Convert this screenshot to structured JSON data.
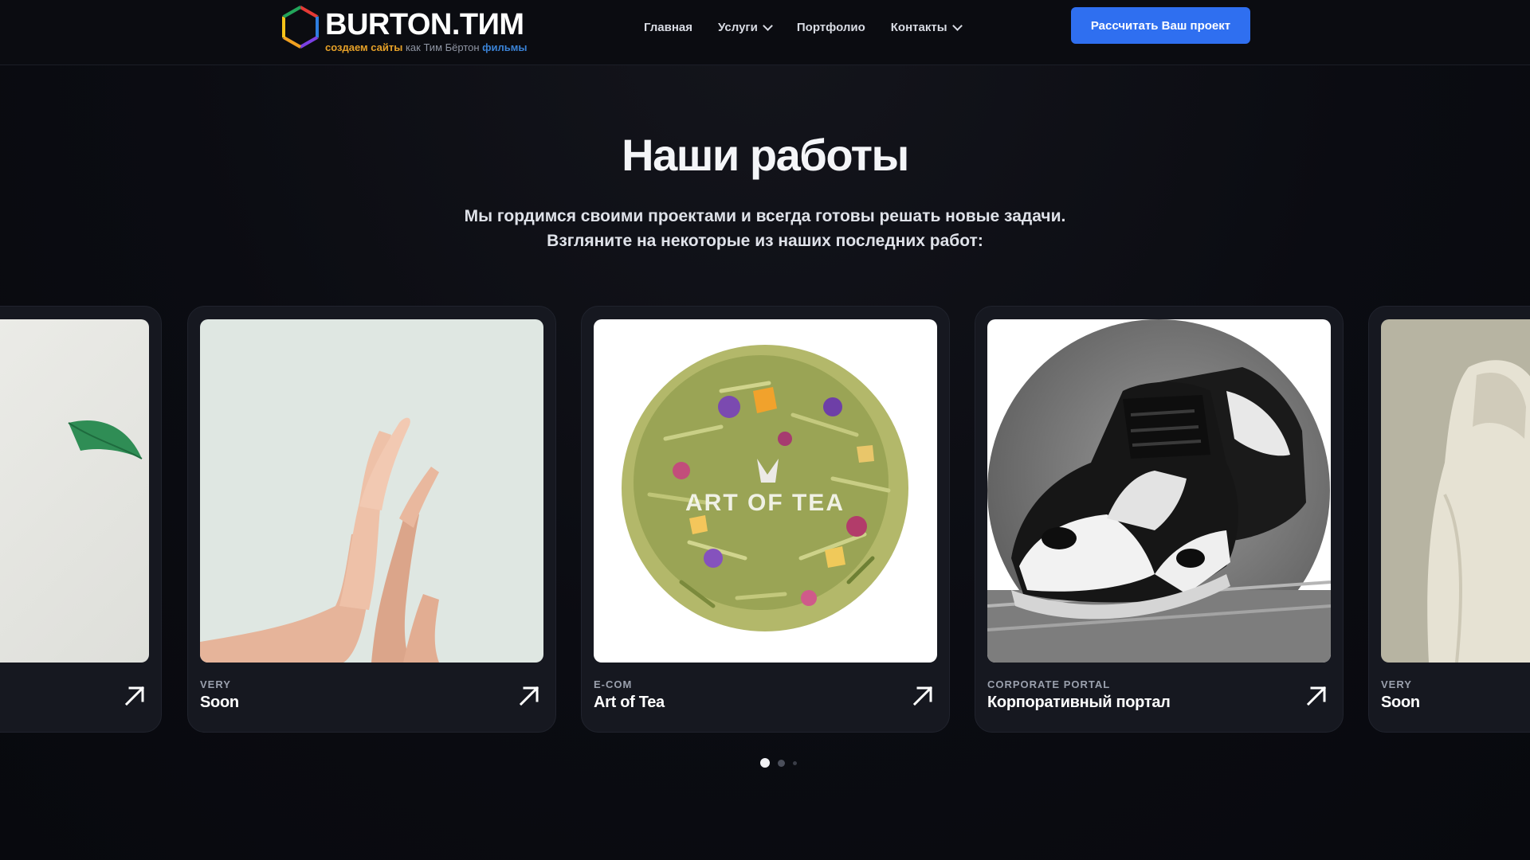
{
  "header": {
    "logo_title": "BURTON.ТИМ",
    "logo_tag_part1": "создаем сайты",
    "logo_tag_part2": "как Тим Бёртон",
    "logo_tag_part3": "фильмы",
    "nav": [
      {
        "label": "Главная",
        "has_dropdown": false
      },
      {
        "label": "Услуги",
        "has_dropdown": true
      },
      {
        "label": "Портфолио",
        "has_dropdown": false
      },
      {
        "label": "Контакты",
        "has_dropdown": true
      }
    ],
    "cta_label": "Рассчитать Ваш проект"
  },
  "section": {
    "title": "Наши работы",
    "subtitle_line1": "Мы гордимся своими проектами и всегда готовы решать новые задачи.",
    "subtitle_line2": "Взгляните на некоторые из наших последних работ:"
  },
  "cards": [
    {
      "category": "",
      "name": "",
      "image": "leaf-on-light-background"
    },
    {
      "category": "VERY",
      "name": "Soon",
      "image": "hands-on-mint-background"
    },
    {
      "category": "E-COM",
      "name": "Art of Tea",
      "image": "loose-tea-blend",
      "image_text": "ART OF TEA"
    },
    {
      "category": "CORPORATE PORTAL",
      "name": "Корпоративный портал",
      "image": "black-white-sneakers"
    },
    {
      "category": "VERY",
      "name": "Soon",
      "image": "person-in-beige-hoodie"
    }
  ],
  "pagination": {
    "pages": 3,
    "active": 1
  },
  "colors": {
    "background": "#0a0b10",
    "card": "#161820",
    "accent": "#2f6ff0",
    "logo_orange": "#e5a028",
    "logo_blue": "#3a82d6"
  }
}
